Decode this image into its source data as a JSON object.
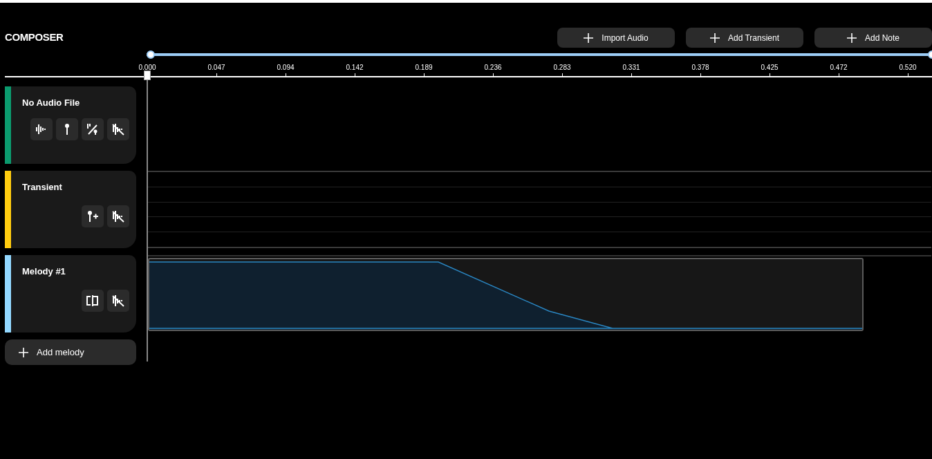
{
  "header": {
    "title": "COMPOSER",
    "buttons": [
      "Import Audio",
      "Add Transient",
      "Add Note"
    ]
  },
  "range_slider": {
    "level": 1
  },
  "ruler": {
    "ticks": [
      "0.000",
      "0.047",
      "0.094",
      "0.142",
      "0.189",
      "0.236",
      "0.283",
      "0.331",
      "0.378",
      "0.425",
      "0.472",
      "0.520"
    ]
  },
  "tracks": [
    {
      "name": "No Audio File",
      "color": "#0b9a6e",
      "kind": "audio",
      "tools": [
        {
          "kind": "waveform"
        },
        {
          "kind": "pin"
        },
        {
          "kind": "pin-slash"
        },
        {
          "kind": "mute"
        }
      ]
    },
    {
      "name": "Transient",
      "color": "#ffcc0f",
      "kind": "transient",
      "tools": [
        {
          "kind": "pin-add"
        },
        {
          "kind": "mute"
        }
      ]
    },
    {
      "name": "Melody #1",
      "color": "#93d8ff",
      "kind": "melody",
      "tools": [
        {
          "kind": "split"
        },
        {
          "kind": "mute"
        }
      ]
    }
  ],
  "add_melody": {
    "label": "Add melody"
  }
}
